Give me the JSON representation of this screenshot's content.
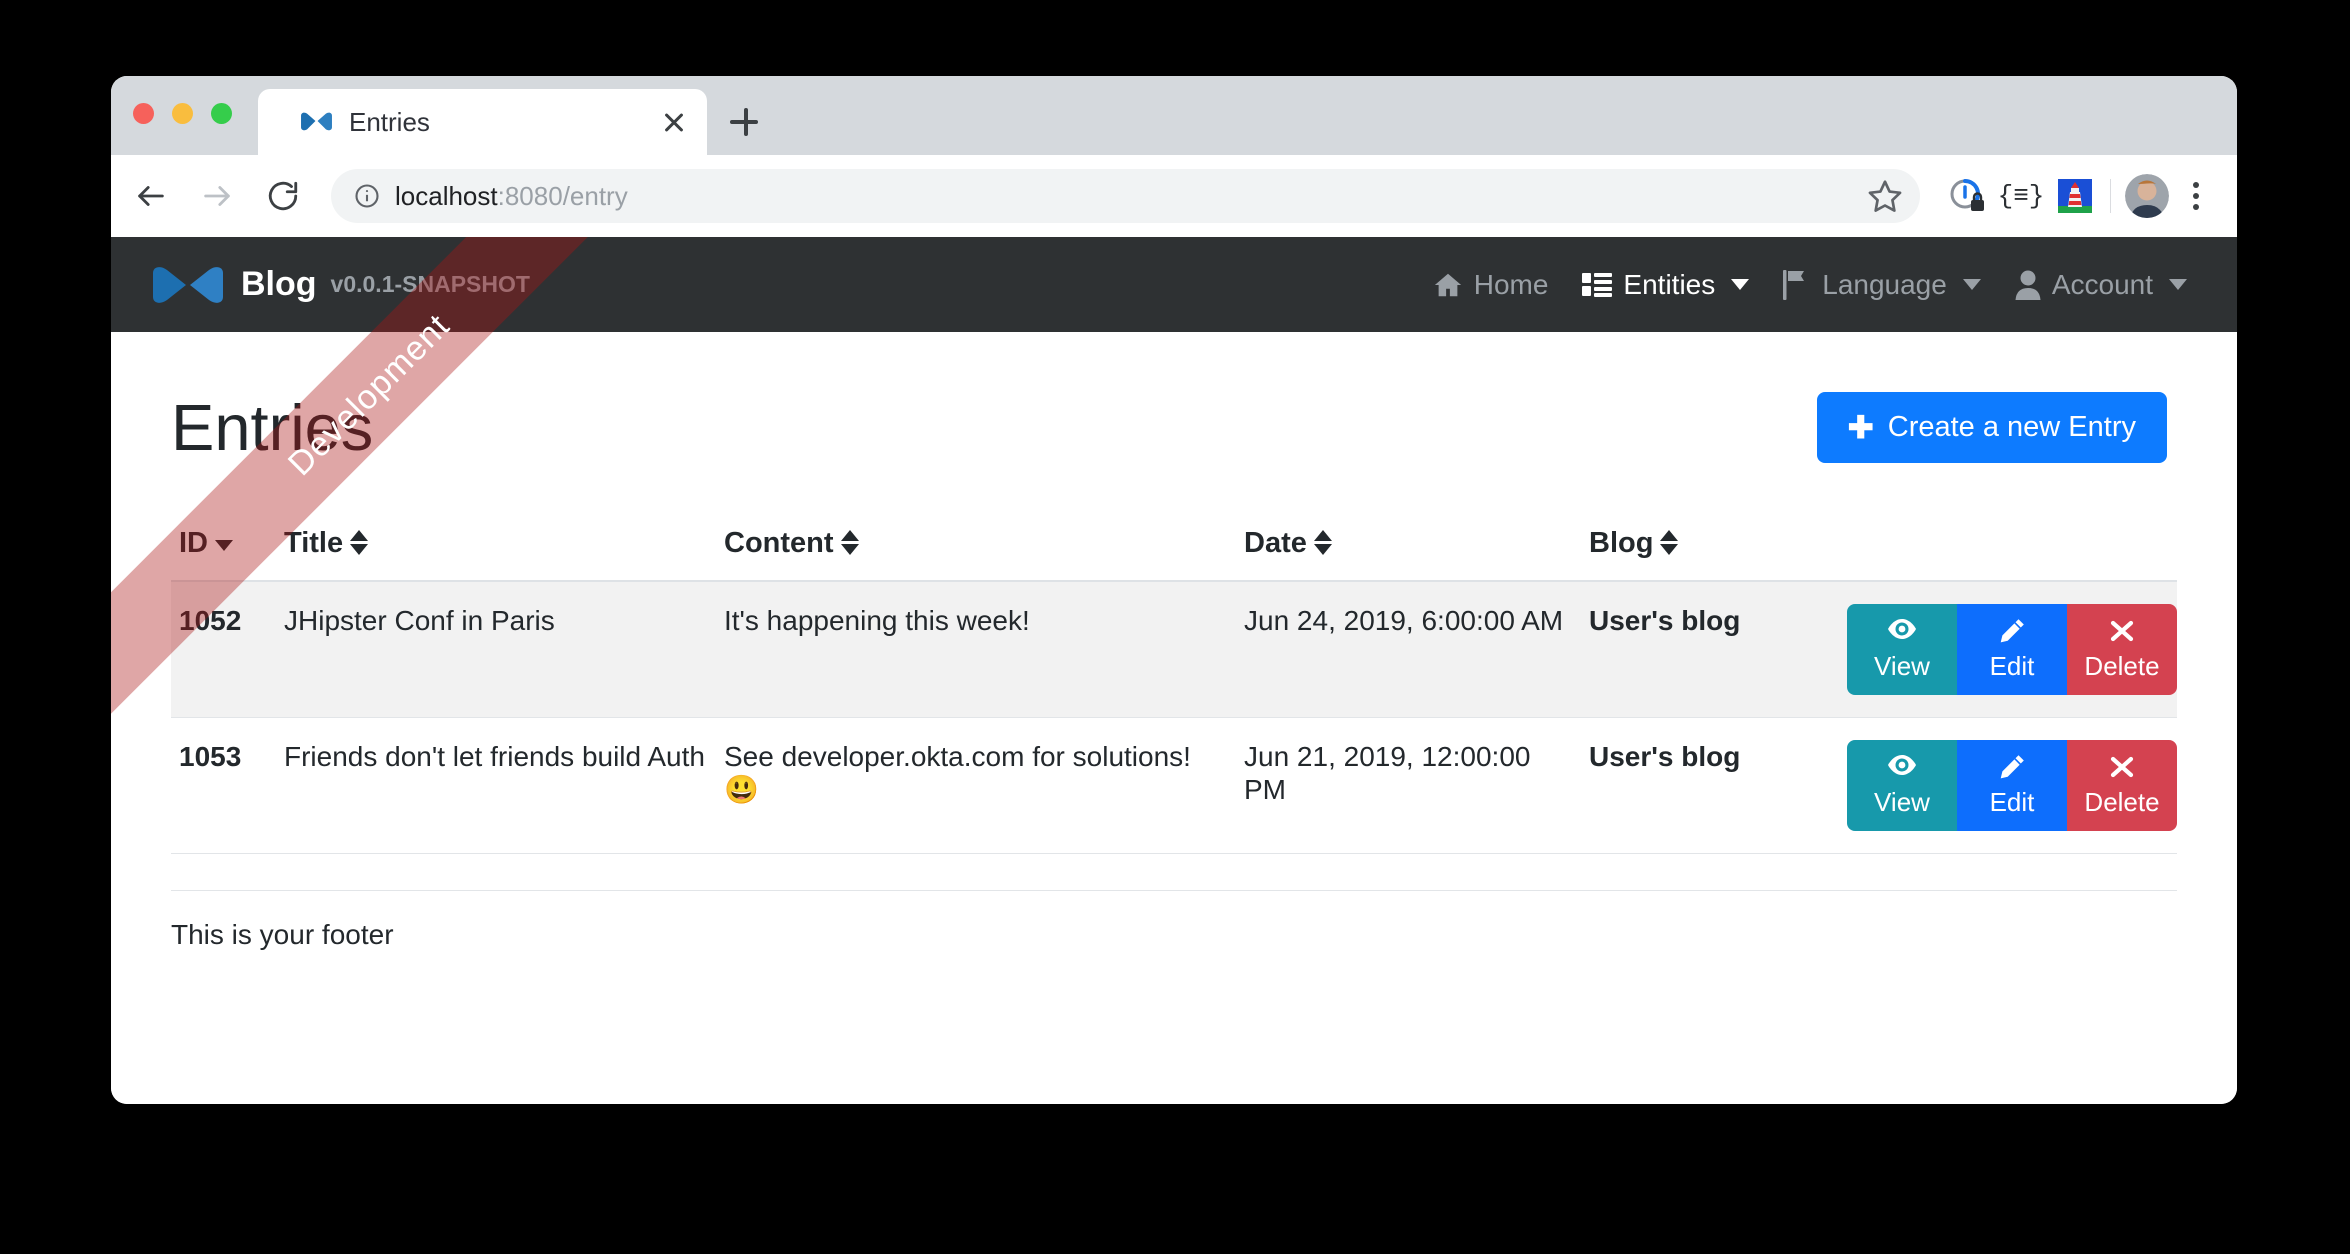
{
  "browser": {
    "tab": {
      "title": "Entries",
      "favicon_icon": "jhipster-bowtie-favicon",
      "close_icon": "close-icon"
    },
    "new_tab_icon": "plus-icon",
    "back_icon": "arrow-left-icon",
    "forward_icon": "arrow-right-icon",
    "reload_icon": "reload-icon",
    "site_info_icon": "info-circle-icon",
    "url_host": "localhost",
    "url_rest": ":8080/entry",
    "bookmark_icon": "star-icon",
    "extensions": [
      {
        "name": "password-manager-icon"
      },
      {
        "name": "json-formatter-icon",
        "glyph": "{≡}"
      },
      {
        "name": "lighthouse-icon"
      }
    ],
    "profile_icon": "avatar",
    "menu_icon": "kebab-menu-icon"
  },
  "ribbon": {
    "label": "Development"
  },
  "navbar": {
    "brand": {
      "logo_icon": "jhipster-bowtie-logo",
      "name": "Blog",
      "version": "v0.0.1-SNAPSHOT"
    },
    "items": [
      {
        "label": "Home",
        "icon": "home-icon",
        "active": false,
        "caret": false
      },
      {
        "label": "Entities",
        "icon": "list-grid-icon",
        "active": true,
        "caret": true
      },
      {
        "label": "Language",
        "icon": "flag-icon",
        "active": false,
        "caret": true
      },
      {
        "label": "Account",
        "icon": "user-icon",
        "active": false,
        "caret": true
      }
    ]
  },
  "page": {
    "title": "Entries",
    "create_button": {
      "label": "Create a new Entry",
      "icon": "plus-icon"
    }
  },
  "table": {
    "columns": [
      {
        "key": "id",
        "label": "ID",
        "sort": "desc"
      },
      {
        "key": "title",
        "label": "Title",
        "sort": "both"
      },
      {
        "key": "content",
        "label": "Content",
        "sort": "both"
      },
      {
        "key": "date",
        "label": "Date",
        "sort": "both"
      },
      {
        "key": "blog",
        "label": "Blog",
        "sort": "both"
      },
      {
        "key": "actions",
        "label": "",
        "sort": "none"
      }
    ],
    "rows": [
      {
        "id": "1052",
        "title": "JHipster Conf in Paris",
        "content": "It's happening this week!",
        "date": "Jun 24, 2019, 6:00:00 AM",
        "blog": "User's blog",
        "striped": true
      },
      {
        "id": "1053",
        "title": "Friends don't let friends build Auth",
        "content": "See developer.okta.com for solutions! 😃",
        "date": "Jun 21, 2019, 12:00:00 PM",
        "blog": "User's blog",
        "striped": false
      }
    ],
    "actions": [
      {
        "key": "view",
        "label": "View",
        "icon": "eye-icon",
        "color": "#1799ab"
      },
      {
        "key": "edit",
        "label": "Edit",
        "icon": "pencil-icon",
        "color": "#0d6efd"
      },
      {
        "key": "delete",
        "label": "Delete",
        "icon": "times-icon",
        "color": "#d44250"
      }
    ]
  },
  "footer": {
    "text": "This is your footer"
  },
  "colors": {
    "navbar_bg": "#2e3133",
    "primary": "#0d7bff",
    "link": "#5c4a0a",
    "view": "#1799ab",
    "edit": "#0d6efd",
    "delete": "#d44250",
    "ribbon": "rgba(170,20,20,0.38)"
  }
}
